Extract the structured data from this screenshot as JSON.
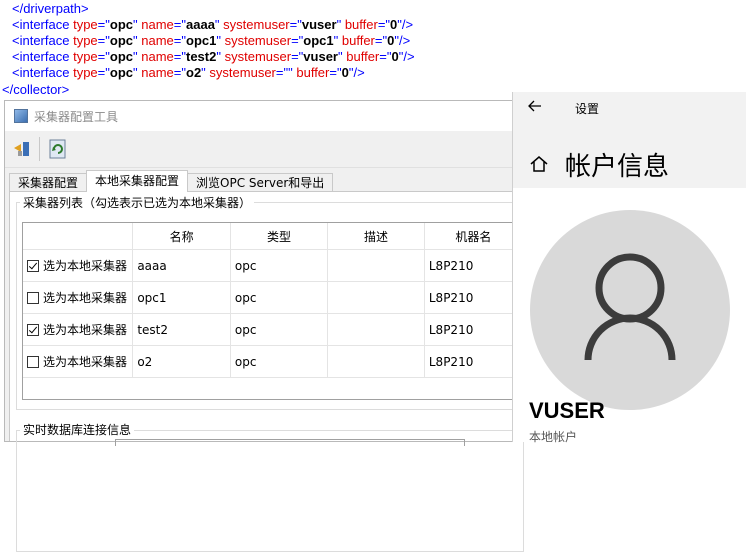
{
  "xml": {
    "line0": "</driverpath>",
    "interfaces": [
      {
        "type": "opc",
        "name": "aaaa",
        "systemuser": "vuser",
        "buffer": "0"
      },
      {
        "type": "opc",
        "name": "opc1",
        "systemuser": "opc1",
        "buffer": "0"
      },
      {
        "type": "opc",
        "name": "test2",
        "systemuser": "vuser",
        "buffer": "0"
      },
      {
        "type": "opc",
        "name": "o2",
        "systemuser": "",
        "buffer": "0"
      }
    ],
    "closing": "collector>"
  },
  "window": {
    "title": "采集器配置工具",
    "tabs": [
      "采集器配置",
      "本地采集器配置",
      "浏览OPC Server和导出"
    ],
    "active_tab": 1
  },
  "collector_group": {
    "label": "采集器列表（勾选表示已选为本地采集器）",
    "columns": [
      "",
      "名称",
      "类型",
      "描述",
      "机器名"
    ],
    "rows": [
      {
        "checked": true,
        "select_label": "选为本地采集器",
        "name": "aaaa",
        "type": "opc",
        "desc": "",
        "machine": "L8P210"
      },
      {
        "checked": false,
        "select_label": "选为本地采集器",
        "name": "opc1",
        "type": "opc",
        "desc": "",
        "machine": "L8P210"
      },
      {
        "checked": true,
        "select_label": "选为本地采集器",
        "name": "test2",
        "type": "opc",
        "desc": "",
        "machine": "L8P210"
      },
      {
        "checked": false,
        "select_label": "选为本地采集器",
        "name": "o2",
        "type": "opc",
        "desc": "",
        "machine": "L8P210"
      }
    ]
  },
  "rtdb_group": {
    "label": "实时数据库连接信息"
  },
  "settings": {
    "title": "设置",
    "heading": "帐户信息",
    "user_name": "VUSER",
    "user_type": "本地帐户",
    "icons": {
      "back": "arrow-left-icon",
      "home": "home-icon",
      "avatar": "person-icon"
    }
  }
}
